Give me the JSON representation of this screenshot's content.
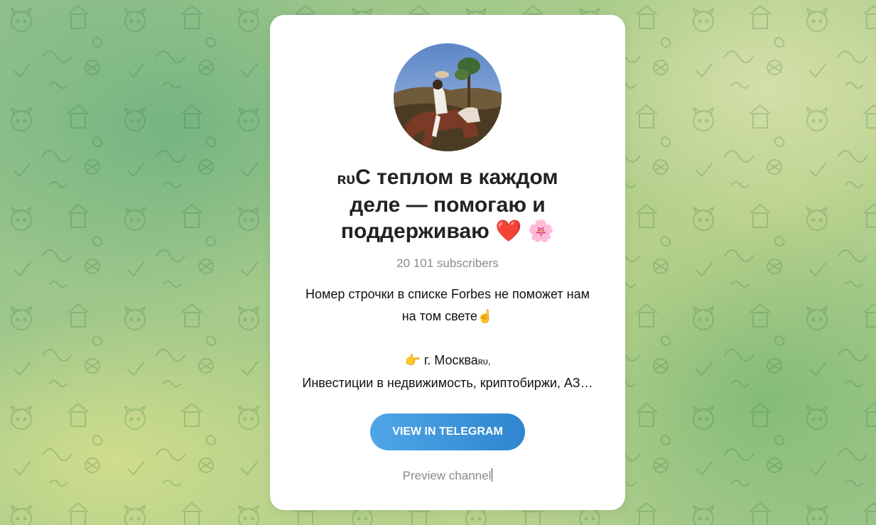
{
  "channel": {
    "title_line1_prefix": "ʀᴜ",
    "title_line1": "С теплом в каждом",
    "title_line2": "деле — помогаю и",
    "title_line3": "поддерживаю",
    "title_emoji": "❤️ 🌸",
    "subscribers": "20 101 subscribers",
    "description": {
      "line1": "Номер строчки в списке Forbes не поможет нам",
      "line2": "на том свете☝️",
      "line3_emoji": "👉",
      "line3": " г. Москва",
      "line3_suffix": "ʀᴜ,",
      "line4": "Инвестиции в недвижимость, криптобиржи, АЗ…"
    }
  },
  "actions": {
    "view_button": "VIEW IN TELEGRAM",
    "preview_link": "Preview channel"
  },
  "colors": {
    "button_start": "#4fa6e6",
    "button_end": "#2f86cf",
    "muted_text": "#8a8a8a",
    "heart": "#e8304f",
    "flower": "#f48aa8"
  }
}
